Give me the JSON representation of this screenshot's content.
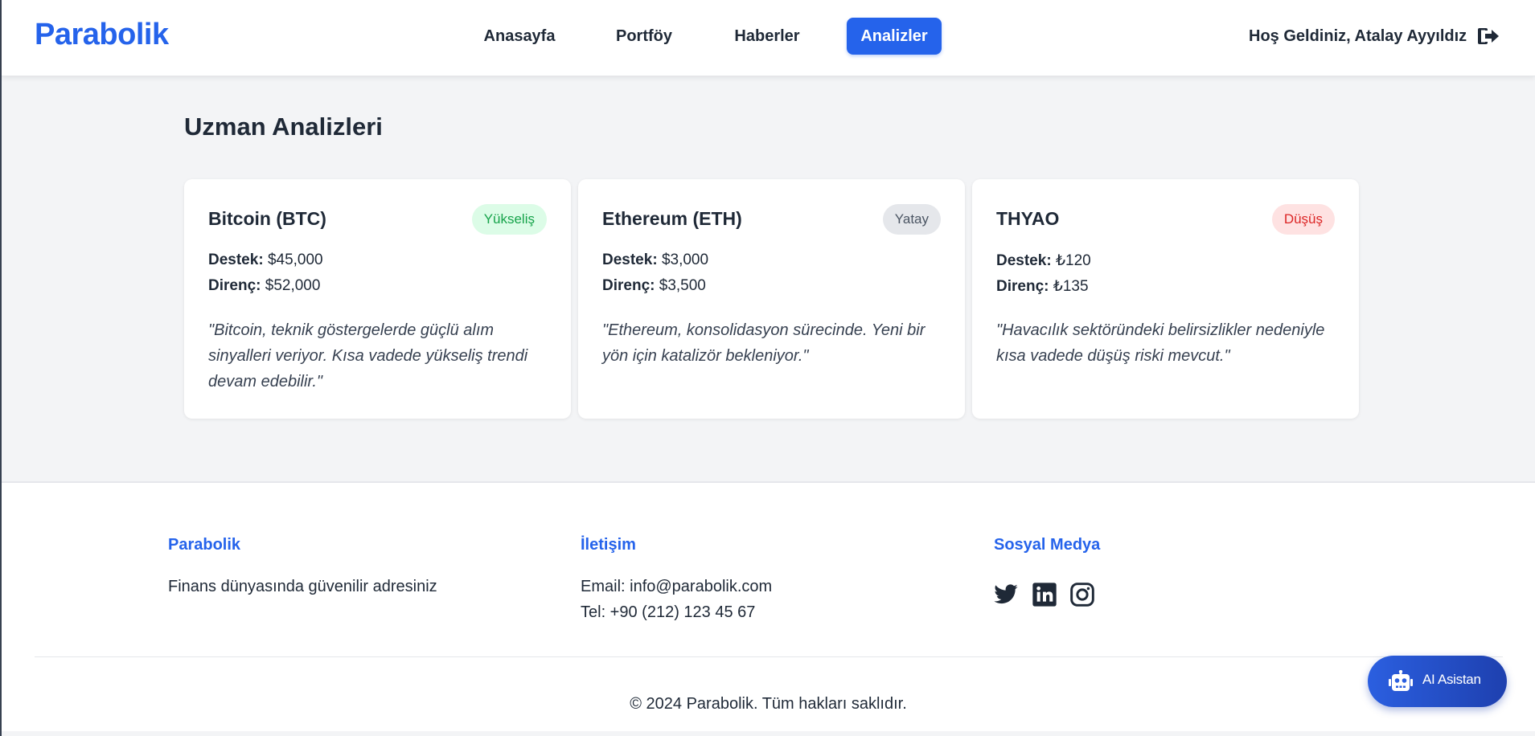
{
  "navbar": {
    "brand": "Parabolik",
    "links": [
      {
        "label": "Anasayfa",
        "active": false
      },
      {
        "label": "Portföy",
        "active": false
      },
      {
        "label": "Haberler",
        "active": false
      },
      {
        "label": "Analizler",
        "active": true
      }
    ],
    "welcome": "Hoş Geldiniz, Atalay Ayyıldız",
    "logout_icon": "logout-icon"
  },
  "main": {
    "title": "Uzman Analizleri",
    "support_label": "Destek:",
    "resistance_label": "Direnç:",
    "cards": [
      {
        "name": "Bitcoin (BTC)",
        "trend": "Yükseliş",
        "trend_type": "up",
        "support": "$45,000",
        "resistance": "$52,000",
        "comment": "\"Bitcoin, teknik göstergelerde güçlü alım sinyalleri veriyor. Kısa vadede yükseliş trendi devam edebilir.\""
      },
      {
        "name": "Ethereum (ETH)",
        "trend": "Yatay",
        "trend_type": "flat",
        "support": "$3,000",
        "resistance": "$3,500",
        "comment": "\"Ethereum, konsolidasyon sürecinde. Yeni bir yön için katalizör bekleniyor.\""
      },
      {
        "name": "THYAO",
        "trend": "Düşüş",
        "trend_type": "down",
        "support": "₺120",
        "resistance": "₺135",
        "comment": "\"Havacılık sektöründeki belirsizlikler nedeniyle kısa vadede düşüş riski mevcut.\""
      }
    ]
  },
  "footer": {
    "about": {
      "title": "Parabolik",
      "text": "Finans dünyasında güvenilir adresiniz"
    },
    "contact": {
      "title": "İletişim",
      "email": "Email: info@parabolik.com",
      "phone": "Tel: +90 (212) 123 45 67"
    },
    "social": {
      "title": "Sosyal Medya",
      "icons": [
        "twitter-icon",
        "linkedin-icon",
        "instagram-icon"
      ]
    },
    "copyright": "© 2024 Parabolik. Tüm hakları saklıdır."
  },
  "ai_assistant": {
    "label": "AI Asistan",
    "icon": "robot-icon"
  },
  "colors": {
    "brand": "#2563eb",
    "up": "#16a34a",
    "flat": "#4b5563",
    "down": "#dc2626",
    "background": "#f3f4f6"
  }
}
